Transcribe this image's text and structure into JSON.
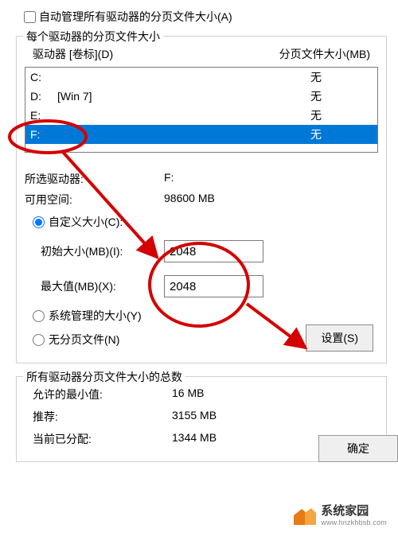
{
  "auto_manage": {
    "label": "自动管理所有驱动器的分页文件大小(A)"
  },
  "per_drive_group_title": "每个驱动器的分页文件大小",
  "header": {
    "drive_col": "驱动器 [卷标](D)",
    "pagefile_col": "分页文件大小(MB)"
  },
  "drives": [
    {
      "letter": "C:",
      "volume": "",
      "pagefile": "无",
      "selected": false
    },
    {
      "letter": "D:",
      "volume": "[Win 7]",
      "pagefile": "无",
      "selected": false
    },
    {
      "letter": "E:",
      "volume": "",
      "pagefile": "无",
      "selected": false
    },
    {
      "letter": "F:",
      "volume": "",
      "pagefile": "无",
      "selected": true
    }
  ],
  "selected_drive": {
    "label": "所选驱动器:",
    "value": "F:"
  },
  "space_available": {
    "label": "可用空间:",
    "value": "98600 MB"
  },
  "size_options": {
    "custom_label": "自定义大小(C):",
    "system_label": "系统管理的大小(Y)",
    "none_label": "无分页文件(N)",
    "selected": "custom"
  },
  "initial_size": {
    "label": "初始大小(MB)(I):",
    "value": "2048"
  },
  "max_size": {
    "label": "最大值(MB)(X):",
    "value": "2048"
  },
  "set_btn": "设置(S)",
  "totals_group_title": "所有驱动器分页文件大小的总数",
  "totals": {
    "min_allowed": {
      "label": "允许的最小值:",
      "value": "16 MB"
    },
    "recommended": {
      "label": "推荐:",
      "value": "3155 MB"
    },
    "allocated": {
      "label": "当前已分配:",
      "value": "1344 MB"
    }
  },
  "ok_btn": "确定",
  "watermark": {
    "title": "系统家园",
    "url": "www.hnzkhbsb.com"
  }
}
